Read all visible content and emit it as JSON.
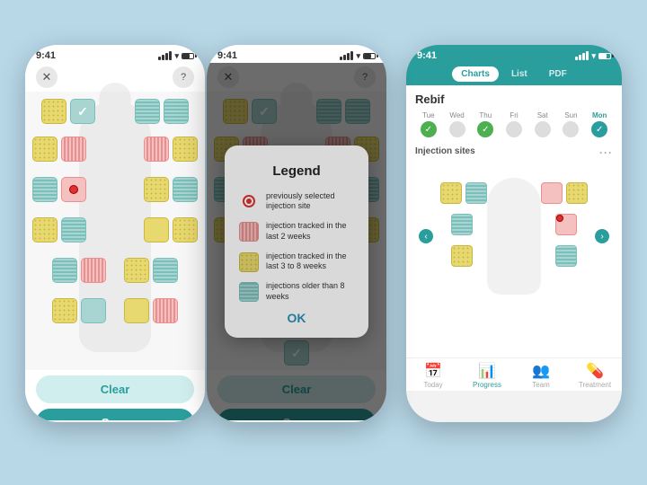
{
  "phone1": {
    "status_time": "9:41",
    "close_btn": "✕",
    "help_btn": "?",
    "clear_label": "Clear",
    "save_label": "Save"
  },
  "phone2": {
    "status_time": "9:41",
    "close_btn": "✕",
    "help_btn": "?",
    "clear_label": "Clear",
    "save_label": "Save",
    "modal": {
      "title": "Legend",
      "item1": "previously selected injection site",
      "item2": "injection tracked in the last 2 weeks",
      "item3": "injection tracked in the last 3 to 8 weeks",
      "item4": "injections older than 8 weeks",
      "ok_label": "OK"
    }
  },
  "phone3": {
    "status_time": "9:41",
    "tabs": [
      "Charts",
      "List",
      "PDF"
    ],
    "active_tab": "Charts",
    "drug_name": "Rebif",
    "days": [
      {
        "label": "Tue",
        "state": "check"
      },
      {
        "label": "Wed",
        "state": "dot"
      },
      {
        "label": "Thu",
        "state": "check"
      },
      {
        "label": "Fri",
        "state": "dot"
      },
      {
        "label": "Sat",
        "state": "dot"
      },
      {
        "label": "Sun",
        "state": "dot"
      },
      {
        "label": "Mon",
        "state": "active_check"
      }
    ],
    "section_title": "Injection sites",
    "nav_items": [
      {
        "label": "Today",
        "icon": "📅"
      },
      {
        "label": "Progress",
        "icon": "📊",
        "active": true
      },
      {
        "label": "Team",
        "icon": "👥"
      },
      {
        "label": "Treatment",
        "icon": "💊"
      }
    ]
  }
}
